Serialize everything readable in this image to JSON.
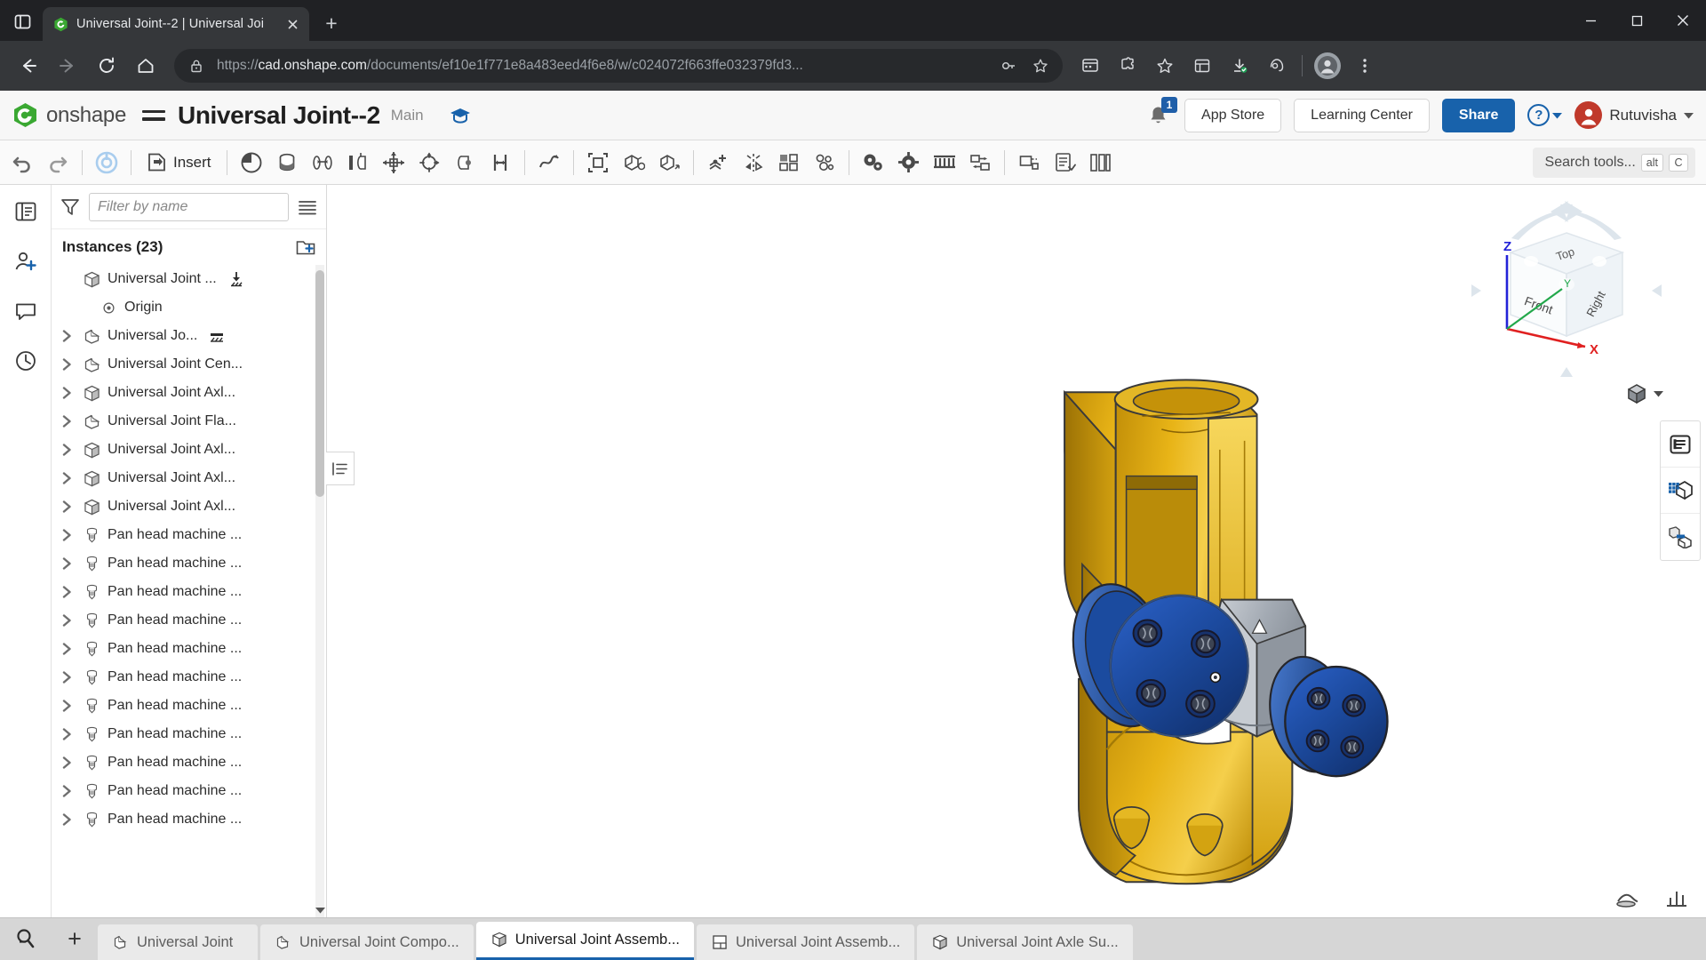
{
  "browser": {
    "tab": {
      "title": "Universal Joint--2 | Universal Joi",
      "favicon_name": "onshape-favicon"
    },
    "new_tab_label": "+",
    "url_prefix": "https://",
    "url_domain": "cad.onshape.com",
    "url_path": "/documents/ef10e1f771e8a483eed4f6e8/w/c024072f663ffe032379fd3...",
    "window_controls": {
      "minimize": "─",
      "maximize": "□",
      "close": "✕"
    }
  },
  "onshape_header": {
    "brand": "onshape",
    "document_title": "Universal Joint--2",
    "branch": "Main",
    "notification_count": "1",
    "app_store_label": "App Store",
    "learning_center_label": "Learning Center",
    "share_label": "Share",
    "help_glyph": "?",
    "user_name": "Rutuvisha"
  },
  "toolbar": {
    "insert_label": "Insert",
    "search_label": "Search tools...",
    "search_kbd_alt": "alt",
    "search_kbd_key": "C",
    "icons": [
      "undo-icon",
      "redo-icon",
      "sync-icon",
      "insert-icon",
      "mate-connector-icon",
      "revolute-mate-icon",
      "cylindrical-mate-icon",
      "slider-mate-icon",
      "planar-mate-icon",
      "ball-mate-icon",
      "pin-slot-mate-icon",
      "fastened-mate-icon",
      "parallel-mate-icon",
      "tangent-mate-icon",
      "group-icon",
      "replicate-icon",
      "transform-icon",
      "mate-connector-add-icon",
      "mirror-icon",
      "pattern-icon",
      "assembly-feature-icon",
      "gear-relation-icon",
      "belt-relation-icon",
      "rack-pinion-icon",
      "screw-relation-icon",
      "exploded-view-icon",
      "bom-icon",
      "measure-icon"
    ]
  },
  "left_rail": {
    "items": [
      {
        "name": "feature-list-icon"
      },
      {
        "name": "add-person-icon"
      },
      {
        "name": "comment-icon"
      },
      {
        "name": "history-icon"
      }
    ]
  },
  "panel": {
    "filter_placeholder": "Filter by name",
    "filter_icon": "funnel-icon",
    "list_view_icon": "list-view-icon",
    "instances_label": "Instances (23)",
    "add_instance_icon": "add-folder-icon",
    "tree": [
      {
        "label": "Universal Joint ...",
        "icon": "part-studio-icon",
        "chevron": false,
        "indent": 0,
        "trailing": "fixed-icon"
      },
      {
        "label": "Origin",
        "icon": "origin-icon",
        "chevron": false,
        "indent": 1,
        "trailing": ""
      },
      {
        "label": "Universal Jo...",
        "icon": "part-icon",
        "chevron": true,
        "indent": 0,
        "trailing": "ground-icon"
      },
      {
        "label": "Universal Joint Cen...",
        "icon": "part-icon",
        "chevron": true,
        "indent": 0,
        "trailing": ""
      },
      {
        "label": "Universal Joint Axl...",
        "icon": "part-studio-icon",
        "chevron": true,
        "indent": 0,
        "trailing": ""
      },
      {
        "label": "Universal Joint Fla...",
        "icon": "part-icon",
        "chevron": true,
        "indent": 0,
        "trailing": ""
      },
      {
        "label": "Universal Joint Axl...",
        "icon": "part-studio-icon",
        "chevron": true,
        "indent": 0,
        "trailing": ""
      },
      {
        "label": "Universal Joint Axl...",
        "icon": "part-studio-icon",
        "chevron": true,
        "indent": 0,
        "trailing": ""
      },
      {
        "label": "Universal Joint Axl...",
        "icon": "part-studio-icon",
        "chevron": true,
        "indent": 0,
        "trailing": ""
      },
      {
        "label": "Pan head machine ...",
        "icon": "screw-icon",
        "chevron": true,
        "indent": 0,
        "trailing": ""
      },
      {
        "label": "Pan head machine ...",
        "icon": "screw-icon",
        "chevron": true,
        "indent": 0,
        "trailing": ""
      },
      {
        "label": "Pan head machine ...",
        "icon": "screw-icon",
        "chevron": true,
        "indent": 0,
        "trailing": ""
      },
      {
        "label": "Pan head machine ...",
        "icon": "screw-icon",
        "chevron": true,
        "indent": 0,
        "trailing": ""
      },
      {
        "label": "Pan head machine ...",
        "icon": "screw-icon",
        "chevron": true,
        "indent": 0,
        "trailing": ""
      },
      {
        "label": "Pan head machine ...",
        "icon": "screw-icon",
        "chevron": true,
        "indent": 0,
        "trailing": ""
      },
      {
        "label": "Pan head machine ...",
        "icon": "screw-icon",
        "chevron": true,
        "indent": 0,
        "trailing": ""
      },
      {
        "label": "Pan head machine ...",
        "icon": "screw-icon",
        "chevron": true,
        "indent": 0,
        "trailing": ""
      },
      {
        "label": "Pan head machine ...",
        "icon": "screw-icon",
        "chevron": true,
        "indent": 0,
        "trailing": ""
      },
      {
        "label": "Pan head machine ...",
        "icon": "screw-icon",
        "chevron": true,
        "indent": 0,
        "trailing": ""
      },
      {
        "label": "Pan head machine ...",
        "icon": "screw-icon",
        "chevron": true,
        "indent": 0,
        "trailing": ""
      }
    ]
  },
  "viewport": {
    "view_cube": {
      "face_top": "Top",
      "face_front": "Front",
      "face_right": "Right",
      "axis_x": "X",
      "axis_y": "Y",
      "axis_z": "Z",
      "axis_x_color": "#e02020",
      "axis_y_color": "#22a84b",
      "axis_z_color": "#2222d8"
    },
    "model": {
      "name": "universal-joint-assembly",
      "color_yoke": "#d6a411",
      "color_yoke_light": "#f0c53a",
      "color_flange": "#1b4c9c",
      "color_flange_dark": "#133a7a",
      "color_cross": "#a8aeb6"
    },
    "right_dock_icons": [
      "display-panel-icon",
      "appearance-cube-icon",
      "insert-part-icon"
    ],
    "bottom_icons": [
      "render-icon",
      "measure-panel-icon"
    ],
    "view_mode_icon": "shaded-cube-icon"
  },
  "document_tabs": {
    "search_icon": "tab-search-icon",
    "add_label": "+",
    "tabs": [
      {
        "label": "Universal Joint",
        "icon": "part-studio-tab-icon",
        "active": false
      },
      {
        "label": "Universal Joint Compo...",
        "icon": "part-studio-tab-icon",
        "active": false
      },
      {
        "label": "Universal Joint Assemb...",
        "icon": "assembly-tab-icon",
        "active": true
      },
      {
        "label": "Universal Joint Assemb...",
        "icon": "drawing-tab-icon",
        "active": false
      },
      {
        "label": "Universal Joint Axle Su...",
        "icon": "assembly-tab-icon",
        "active": false
      }
    ]
  }
}
